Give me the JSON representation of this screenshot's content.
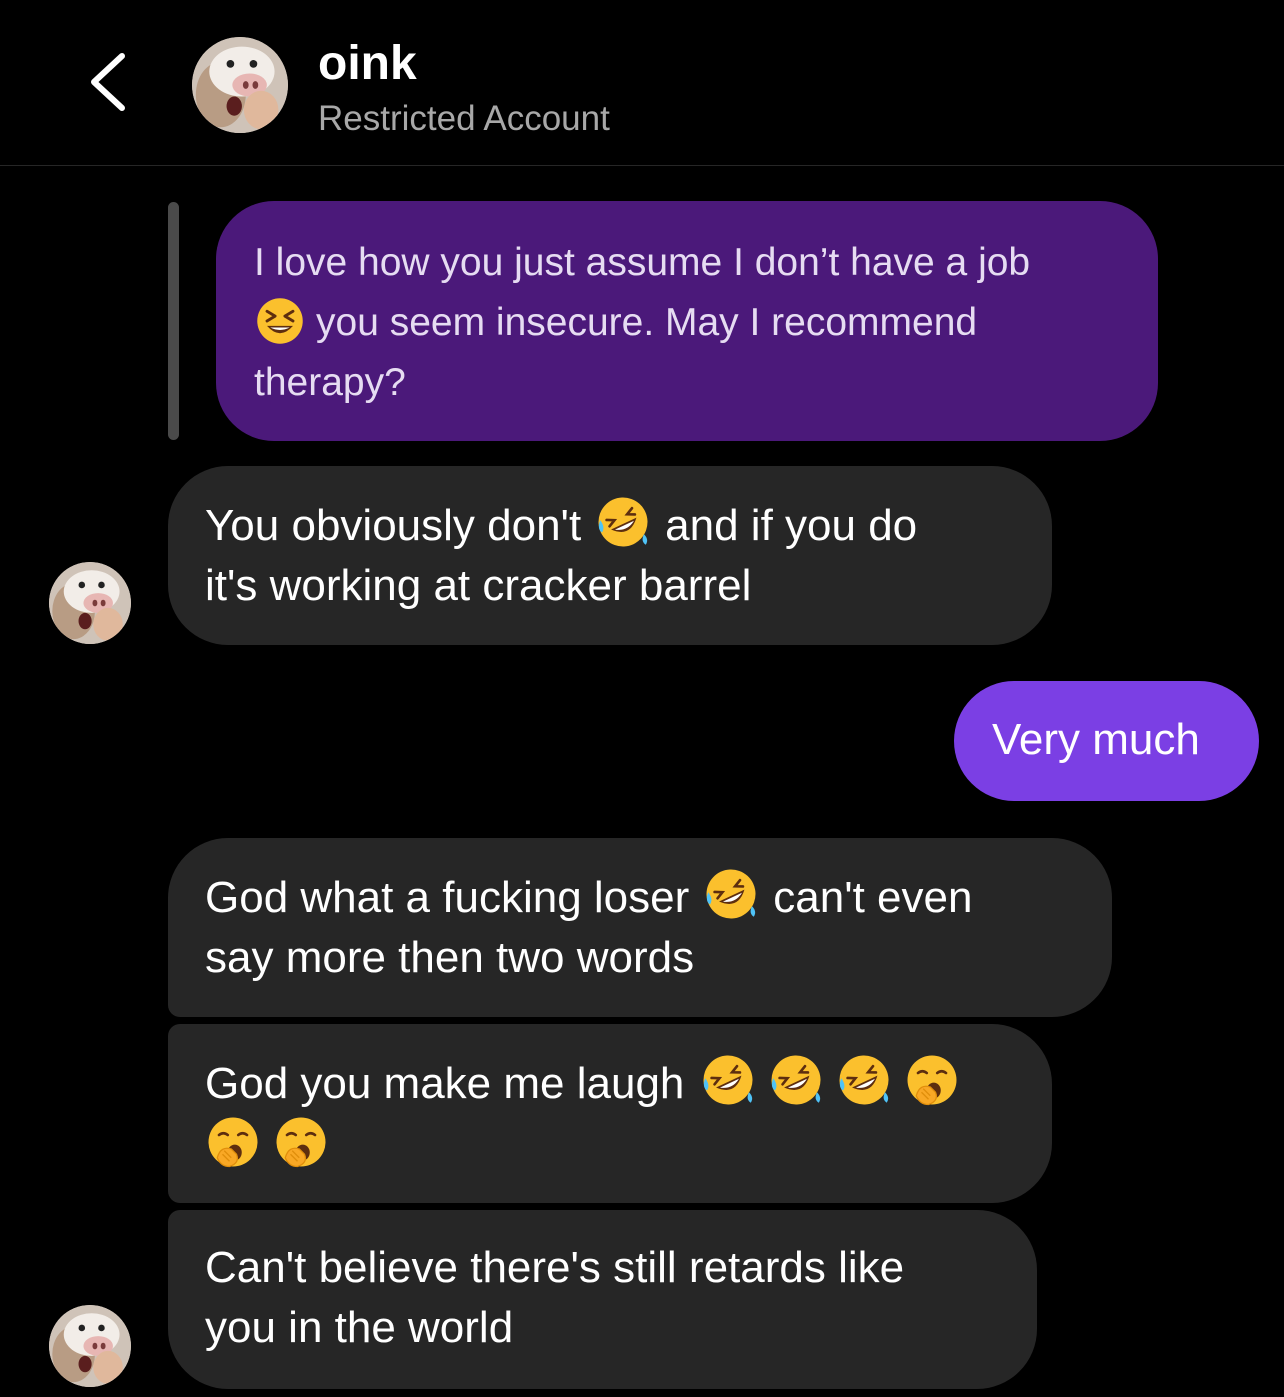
{
  "header": {
    "title": "oink",
    "subtitle": "Restricted Account",
    "back_icon": "chevron-left-icon",
    "avatar_icon": "pig-avatar"
  },
  "messages": [
    {
      "sender": "me",
      "style": "replied-quote",
      "lines": [
        "I love how you just assume I don’t have a job",
        "you seem insecure. May I recommend",
        "therapy?"
      ],
      "emoji": [
        "grinning-squinting-face"
      ]
    },
    {
      "sender": "oink",
      "lines": [
        "You obviously don't",
        "and if you do",
        "it's working at cracker barrel"
      ],
      "emoji": [
        "rolling-on-floor-laughing"
      ]
    },
    {
      "sender": "me",
      "lines": [
        "Very much"
      ]
    },
    {
      "sender": "oink",
      "lines": [
        "God what a fucking loser",
        "can't even",
        "say more then two words"
      ],
      "emoji": [
        "rolling-on-floor-laughing"
      ]
    },
    {
      "sender": "oink",
      "lines": [
        "God you make me laugh"
      ],
      "emoji": [
        "rolling-on-floor-laughing",
        "rolling-on-floor-laughing",
        "rolling-on-floor-laughing",
        "yawning-face",
        "yawning-face",
        "yawning-face"
      ]
    },
    {
      "sender": "oink",
      "lines": [
        "Can't believe there's still retards like",
        "you in the world"
      ]
    }
  ],
  "colors": {
    "background": "#000000",
    "incoming_bubble": "#262626",
    "outgoing_bubble": "#7b3fe4",
    "quoted_bubble": "#4b197a",
    "subtitle": "#a8a8a8"
  }
}
